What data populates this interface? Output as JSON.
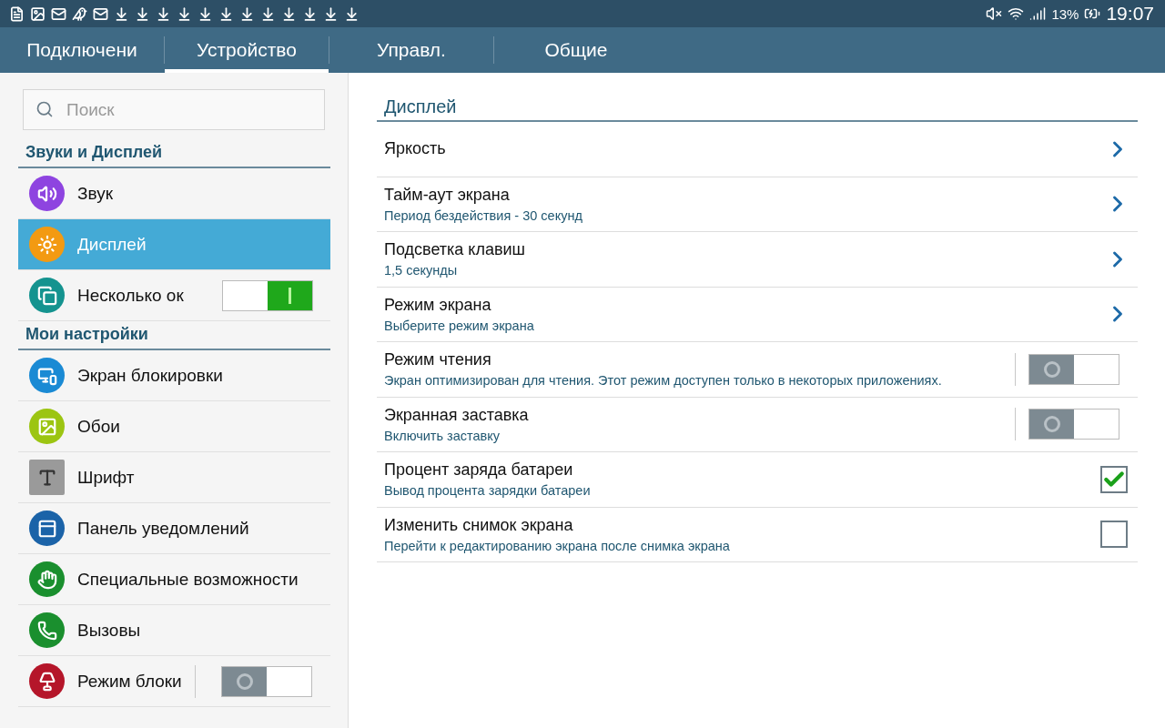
{
  "status_bar": {
    "battery": "13%",
    "time": "19:07"
  },
  "tabs": [
    {
      "label": "Подключени",
      "selected": false
    },
    {
      "label": "Устройство",
      "selected": true
    },
    {
      "label": "Управл.",
      "selected": false
    },
    {
      "label": "Общие",
      "selected": false
    }
  ],
  "sidebar": {
    "search": {
      "placeholder": "Поиск"
    },
    "sections": [
      {
        "title": "Звуки и Дисплей",
        "items": [
          {
            "label": "Звук",
            "color": "#8e44e0",
            "kind": "link",
            "selected": false
          },
          {
            "label": "Дисплей",
            "color": "#f39a12",
            "kind": "link",
            "selected": true
          },
          {
            "label": "Несколько ок",
            "color": "#14938f",
            "kind": "toggle",
            "on": true,
            "selected": false
          }
        ]
      },
      {
        "title": "Мои настройки",
        "items": [
          {
            "label": "Экран блокировки",
            "color": "#1a8ad4",
            "kind": "link",
            "selected": false
          },
          {
            "label": "Обои",
            "color": "#9cc512",
            "kind": "link",
            "selected": false
          },
          {
            "label": "Шрифт",
            "color": "#9a9a9a",
            "kind": "link",
            "selected": false
          },
          {
            "label": "Панель уведомлений",
            "color": "#1b63a8",
            "kind": "link",
            "selected": false
          },
          {
            "label": "Специальные возможности",
            "color": "#1a8f2e",
            "kind": "link",
            "selected": false
          },
          {
            "label": "Вызовы",
            "color": "#1a8f2e",
            "kind": "link",
            "selected": false
          },
          {
            "label": "Режим блоки",
            "color": "#b5162a",
            "kind": "toggle",
            "on": false,
            "selected": false
          }
        ]
      }
    ]
  },
  "content": {
    "title": "Дисплей",
    "rows": [
      {
        "title": "Яркость",
        "kind": "link"
      },
      {
        "title": "Тайм-аут экрана",
        "subtitle": "Период бездействия - 30 секунд",
        "kind": "link"
      },
      {
        "title": "Подсветка клавиш",
        "subtitle": "1,5 секунды",
        "kind": "link"
      },
      {
        "title": "Режим экрана",
        "subtitle": "Выберите режим экрана",
        "kind": "link"
      },
      {
        "title": "Режим чтения",
        "subtitle": "Экран оптимизирован для чтения. Этот режим доступен только в некоторых приложениях.",
        "kind": "toggle",
        "on": false
      },
      {
        "title": "Экранная заставка",
        "subtitle": "Включить заставку",
        "kind": "toggle",
        "on": false
      },
      {
        "title": "Процент заряда батареи",
        "subtitle": "Вывод процента зарядки батареи",
        "kind": "checkbox",
        "checked": true
      },
      {
        "title": "Изменить снимок экрана",
        "subtitle": "Перейти к редактированию экрана после снимка экрана",
        "kind": "checkbox",
        "checked": false
      }
    ]
  }
}
